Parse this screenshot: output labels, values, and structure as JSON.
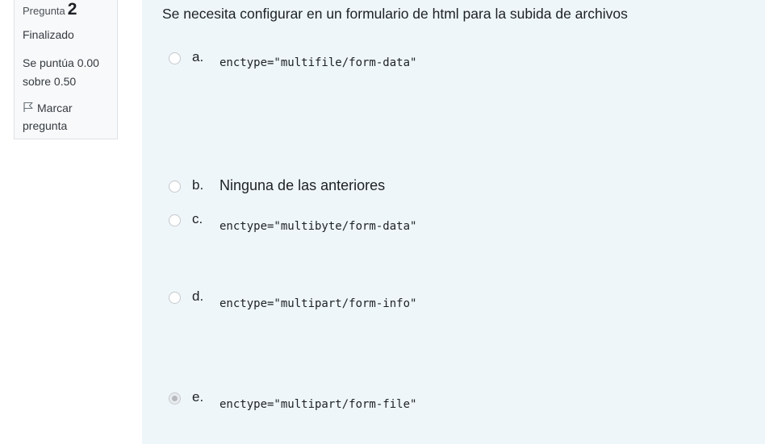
{
  "info": {
    "question_label": "Pregunta",
    "question_number": "2",
    "state": "Finalizado",
    "grade": "Se puntúa 0.00 sobre 0.50",
    "flag_label": "Marcar pregunta"
  },
  "question": {
    "text": "Se necesita configurar en un formulario de html para la subida de archivos",
    "options": [
      {
        "letter": "a.",
        "answer": "enctype=\"multifile/form-data\"",
        "selected": false
      },
      {
        "letter": "b.",
        "answer": "Ninguna de las anteriores",
        "selected": false
      },
      {
        "letter": "c.",
        "answer": "enctype=\"multibyte/form-data\"",
        "selected": false
      },
      {
        "letter": "d.",
        "answer": "enctype=\"multipart/form-info\"",
        "selected": false
      },
      {
        "letter": "e.",
        "answer": "enctype=\"multipart/form-file\"",
        "selected": true
      }
    ]
  }
}
